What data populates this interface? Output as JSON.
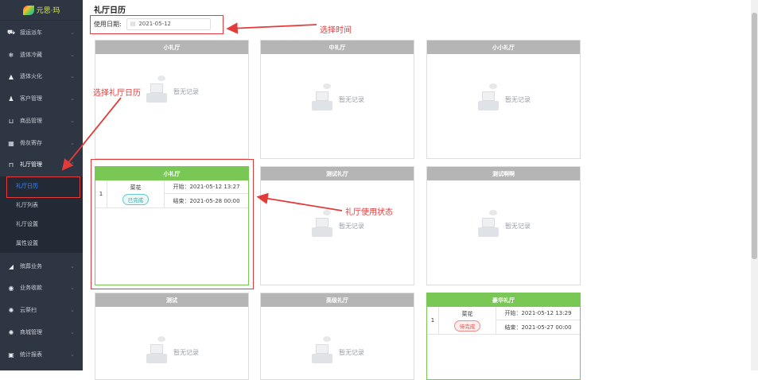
{
  "app": {
    "logo_text": "元思·玛"
  },
  "sidebar": {
    "items": [
      {
        "label": "接运派车",
        "icon": "car-icon"
      },
      {
        "label": "遗体冷藏",
        "icon": "snowflake-icon"
      },
      {
        "label": "遗体火化",
        "icon": "flame-icon"
      },
      {
        "label": "客户管理",
        "icon": "users-icon"
      },
      {
        "label": "商品管理",
        "icon": "cart-icon"
      },
      {
        "label": "骨灰寄存",
        "icon": "grid-icon"
      },
      {
        "label": "礼厅管理",
        "icon": "hall-icon"
      },
      {
        "label": "殡葬业务",
        "icon": "megaphone-icon"
      },
      {
        "label": "业务收款",
        "icon": "money-icon"
      },
      {
        "label": "云祭扫",
        "icon": "flower-icon"
      },
      {
        "label": "商城管理",
        "icon": "shop-icon"
      },
      {
        "label": "统计报表",
        "icon": "chart-icon"
      }
    ],
    "sub_items": [
      "礼厅日历",
      "礼厅列表",
      "礼厅设置",
      "属性设置"
    ]
  },
  "page": {
    "title": "礼厅日历"
  },
  "filter": {
    "date_label": "使用日期:",
    "date_value": "2021-05-12"
  },
  "empty_text": "暂无记录",
  "halls": [
    {
      "name": "小礼厅"
    },
    {
      "name": "中礼厅"
    },
    {
      "name": "小小礼厅"
    },
    {
      "name": "小礼厅",
      "index": "1",
      "person": "菜花",
      "status": "已完成",
      "start": "开始：2021-05-12 13:27",
      "end": "结束：2021-05-28 00:00"
    },
    {
      "name": "测试礼厅"
    },
    {
      "name": "测试啊啊"
    },
    {
      "name": "测试"
    },
    {
      "name": "高级礼厅"
    },
    {
      "name": "豪华礼厅",
      "index": "1",
      "person": "菜花",
      "status": "待完成",
      "start": "开始：2021-05-12 13:29",
      "end": "结束：2021-05-27 00:00"
    }
  ],
  "annotations": {
    "select_time": "选择时间",
    "select_calendar": "选择礼厅日历",
    "usage_status": "礼厅使用状态"
  },
  "colors": {
    "sidebar_bg": "#2e3644",
    "active_blue": "#3c8cff",
    "occupied_green": "#79c855",
    "annotation_red": "#e53a3a"
  }
}
